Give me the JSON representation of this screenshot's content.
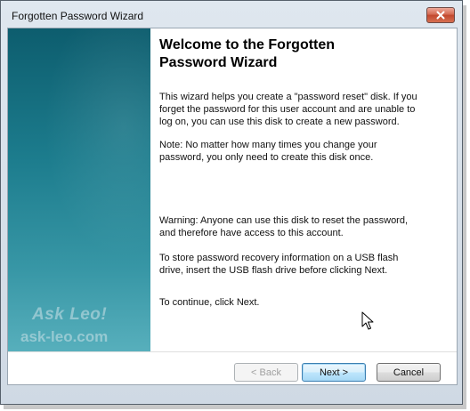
{
  "window": {
    "title": "Forgotten Password Wizard"
  },
  "banner": {
    "watermark_logo": "Ask Leo!",
    "watermark_url": "ask-leo.com"
  },
  "content": {
    "heading": "Welcome to the Forgotten Password Wizard",
    "paragraphs": [
      "This wizard helps you create a \"password reset\" disk. If you forget the password for this user account and are unable to log on, you can use this disk to create a new password.",
      "Note: No matter how many times you change your password, you only need to create this disk once.",
      "Warning: Anyone can use this disk to reset the password, and therefore have access to this account.",
      "To store password recovery information on a USB flash drive, insert the USB flash drive before clicking Next.",
      "To continue, click Next."
    ]
  },
  "buttons": {
    "back": "< Back",
    "next": "Next >",
    "cancel": "Cancel"
  },
  "icons": {
    "close": "close-icon",
    "cursor": "mouse-cursor-icon"
  },
  "colors": {
    "banner_top": "#0d5d6e",
    "banner_bottom": "#57afbc",
    "close_button": "#c2472e",
    "default_button_border": "#3c7fb1"
  }
}
